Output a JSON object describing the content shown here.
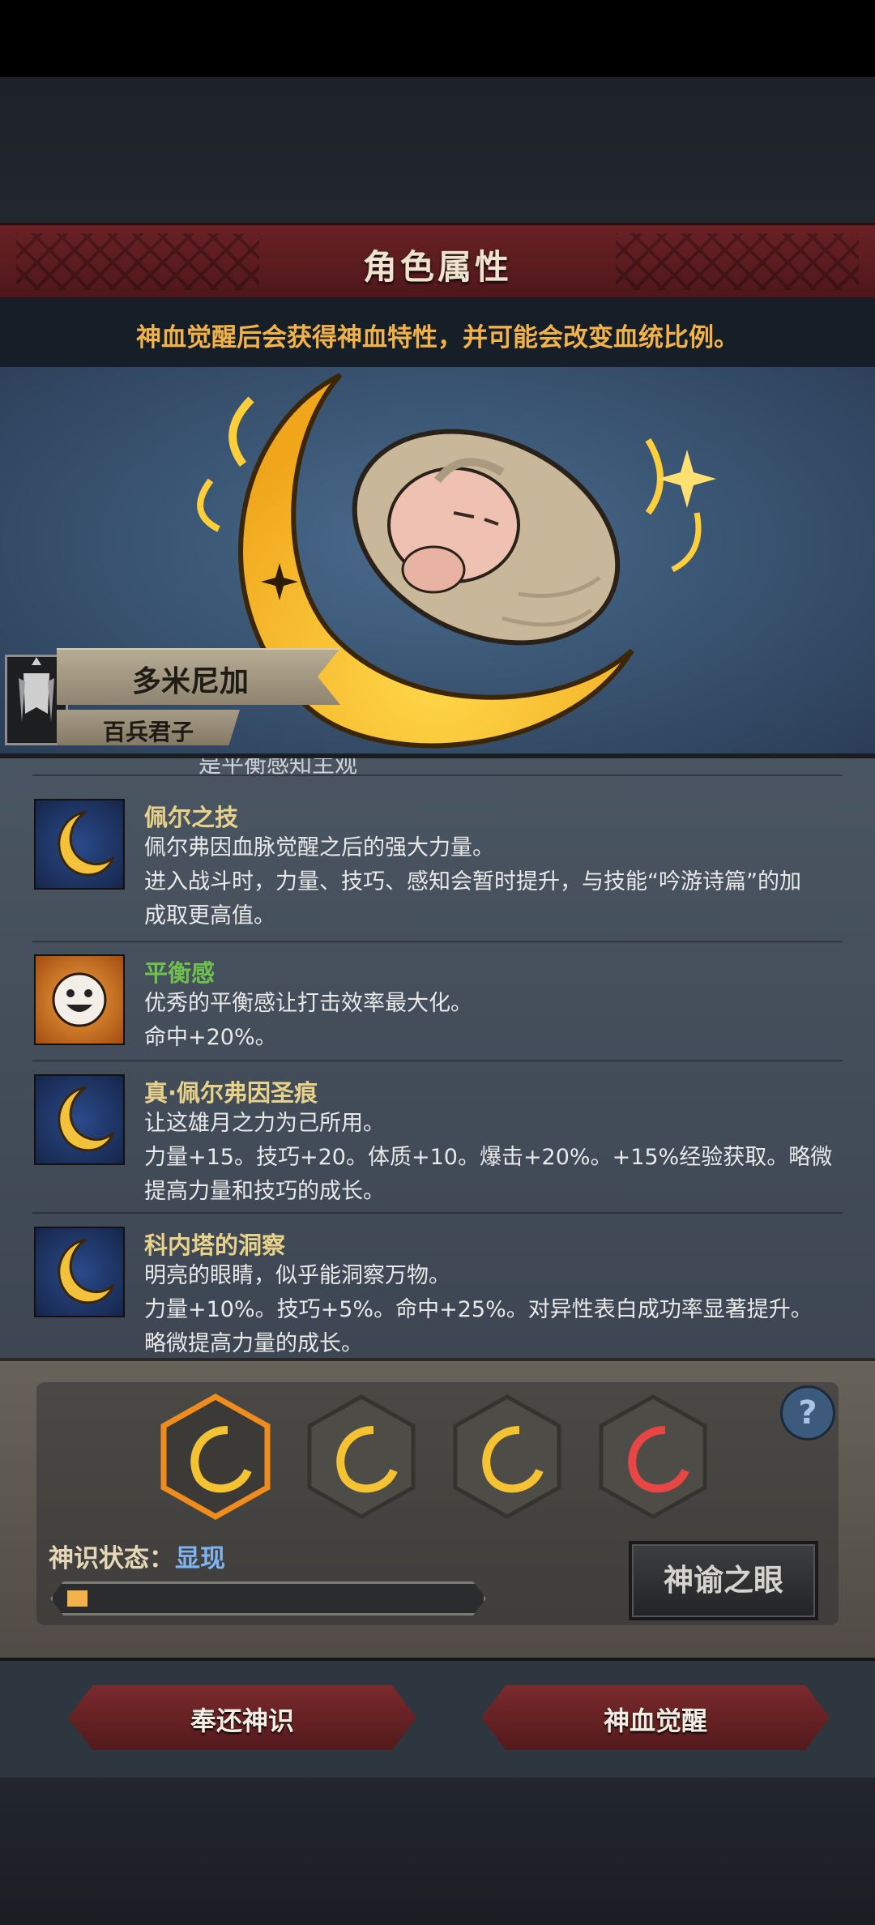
{
  "header": {
    "title": "角色属性",
    "subtitle": "神血觉醒后会获得神血特性，并可能会改变血统比例。"
  },
  "character": {
    "name": "多米尼加",
    "title": "百兵君子"
  },
  "traits": {
    "cut_text": "是平衡感知主观",
    "items": [
      {
        "title": "佩尔之技",
        "title_color": "#e8d28a",
        "icon": "moon-icon",
        "lines": [
          "佩尔弗因血脉觉醒之后的强大力量。",
          "进入战斗时，力量、技巧、感知会暂时提升，与技能“吟游诗篇”的加",
          "成取更高值。"
        ]
      },
      {
        "title": "平衡感",
        "title_color": "#6fc14f",
        "icon": "smiley-icon",
        "lines": [
          "优秀的平衡感让打击效率最大化。",
          "命中+20%。"
        ]
      },
      {
        "title": "真·佩尔弗因圣痕",
        "title_color": "#e8d28a",
        "icon": "moon-icon",
        "lines": [
          "让这雄月之力为己所用。",
          "力量+15。技巧+20。体质+10。爆击+20%。+15%经验获取。略微",
          "提高力量和技巧的成长。"
        ]
      },
      {
        "title": "科内塔的洞察",
        "title_color": "#e8d28a",
        "icon": "moon-icon",
        "lines": [
          "明亮的眼睛，似乎能洞察万物。",
          "力量+10%。技巧+5%。命中+25%。对异性表白成功率显著提升。",
          "略微提高力量的成长。"
        ]
      }
    ]
  },
  "divine_sense": {
    "status_label": "神识状态：",
    "status_value": "显现",
    "progress": 0.05,
    "oracle_button": "神谕之眼",
    "help_label": "?"
  },
  "buttons": {
    "return_label": "奉还神识",
    "awaken_label": "神血觉醒"
  },
  "colors": {
    "accent_gold": "#f2b24a",
    "button_red": "#7a2a2c",
    "status_blue": "#7fb3f0"
  }
}
